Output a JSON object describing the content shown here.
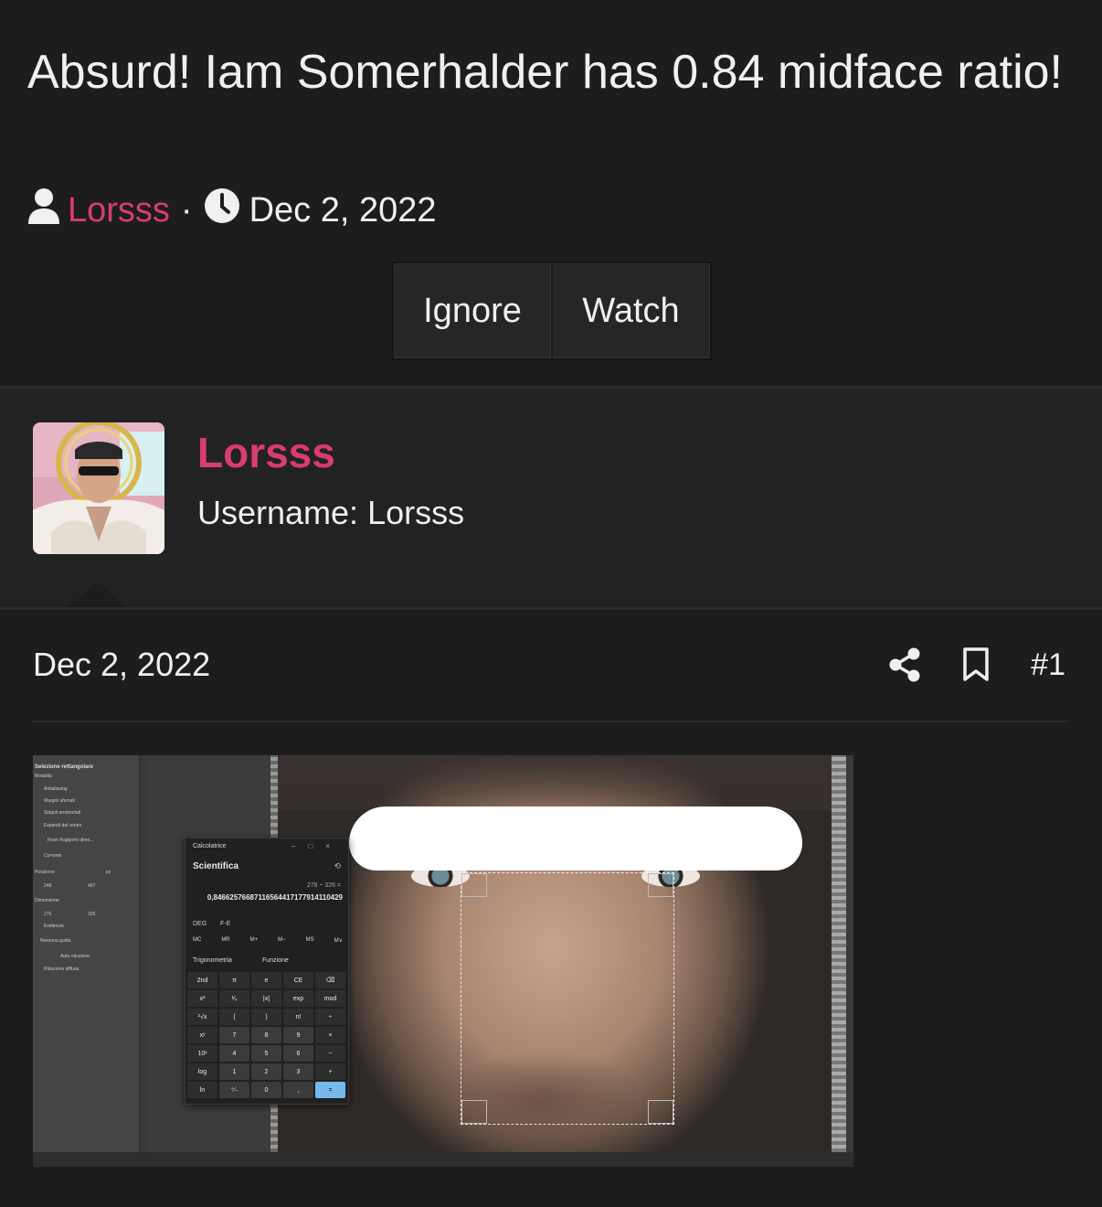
{
  "thread": {
    "title": "Absurd! Iam Somerhalder has 0.84 midface ratio!",
    "author": "Lorsss",
    "date": "Dec 2, 2022",
    "separator": "·",
    "buttons": {
      "ignore": "Ignore",
      "watch": "Watch"
    }
  },
  "user": {
    "name": "Lorsss",
    "username_line": "Username: Lorsss"
  },
  "post": {
    "date": "Dec 2, 2022",
    "number": "#1"
  },
  "screenshot": {
    "calculator": {
      "window_title": "Calcolatrice",
      "mode": "Scientifica",
      "expression": "276 ÷ 326 =",
      "result": "0,84662576687116564417177914110429",
      "deg": "DEG",
      "fe": "F-E",
      "memory": [
        "MC",
        "MR",
        "M+",
        "M−",
        "MS",
        "M∨"
      ],
      "trig_label": "Trigonometria",
      "func_label": "Funzione",
      "keys": [
        "2nd",
        "π",
        "e",
        "CE",
        "⌫",
        "x²",
        "¹⁄ₓ",
        "|x|",
        "exp",
        "mod",
        "²√x",
        "(",
        ")",
        "n!",
        "÷",
        "xʸ",
        "7",
        "8",
        "9",
        "×",
        "10ˣ",
        "4",
        "5",
        "6",
        "−",
        "log",
        "1",
        "2",
        "3",
        "+",
        "ln",
        "⁺⁄₋",
        "0",
        ",",
        "="
      ]
    },
    "tool_panel": {
      "title": "Selezione rettangolare",
      "mode": "Modalità",
      "antialias": "Antialiasing",
      "feather": "Margini sfumati",
      "rounded": "Spigoli arrotondati",
      "expand": "Espandi dal centro",
      "fixed": "Fisso Rapporto dime...",
      "current": "Corrente",
      "position_label": "Posizione:",
      "pos_x": "248",
      "pos_y": "497",
      "size_label": "Dimensione:",
      "width": "276",
      "height": "326",
      "unit": "px",
      "highlight": "Evidenzia",
      "guide": "Nessuna guida",
      "autoshrink": "Auto riduzione",
      "shrink_merged": "Riduzione diffusa"
    }
  },
  "colors": {
    "accent": "#d93d6e",
    "background": "#1d1d1f",
    "user_block": "#222224",
    "button": "#262628"
  },
  "icons": {
    "author": "user-icon",
    "date": "clock-icon",
    "share": "share-icon",
    "bookmark": "bookmark-icon"
  }
}
